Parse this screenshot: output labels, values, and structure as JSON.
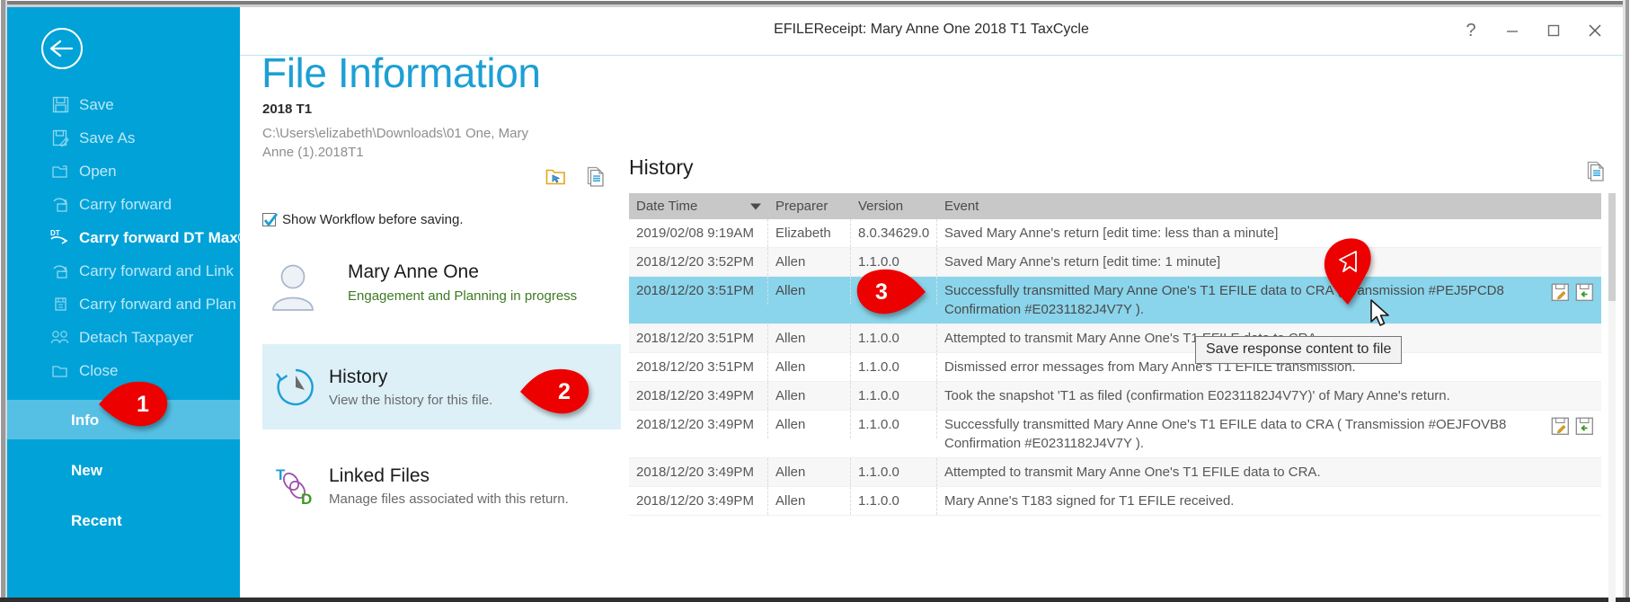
{
  "window": {
    "title": "EFILEReceipt: Mary Anne One 2018 T1 TaxCycle",
    "help_label": "?",
    "minimize_label": "Minimize",
    "maximize_label": "Maximize",
    "close_label": "Close"
  },
  "backstage": {
    "back_label": "Back",
    "items": [
      {
        "label": "Save",
        "icon": "save-icon",
        "enabled": false
      },
      {
        "label": "Save As",
        "icon": "save-as-icon",
        "enabled": false
      },
      {
        "label": "Open",
        "icon": "open-folder-icon",
        "enabled": false
      },
      {
        "label": "Carry forward",
        "icon": "carry-forward-icon",
        "enabled": false
      },
      {
        "label": "Carry forward DT Max®",
        "icon": "carry-forward-dtmax-icon",
        "enabled": true
      },
      {
        "label": "Carry forward and Link",
        "icon": "carry-forward-link-icon",
        "enabled": false
      },
      {
        "label": "Carry forward and Plan",
        "icon": "carry-forward-plan-icon",
        "enabled": false
      },
      {
        "label": "Detach Taxpayer",
        "icon": "detach-taxpayer-icon",
        "enabled": false
      },
      {
        "label": "Close",
        "icon": "close-folder-icon",
        "enabled": false
      }
    ],
    "sections": [
      {
        "label": "Info",
        "active": true
      },
      {
        "label": "New",
        "active": false
      },
      {
        "label": "Recent",
        "active": false
      }
    ]
  },
  "file_info": {
    "page_title": "File Information",
    "year_label": "2018 T1",
    "path": "C:\\Users\\elizabeth\\Downloads\\01 One, Mary Anne (1).2018T1",
    "open_folder_icon": "open-containing-folder-icon",
    "file_icon": "file-properties-icon",
    "workflow_checkbox_label": "Show Workflow before saving.",
    "workflow_checkbox_checked": true,
    "taxpayer": {
      "name": "Mary Anne One",
      "status": "Engagement and Planning in progress",
      "avatar_icon": "person-avatar-icon",
      "badge_icons": [
        "spouse-badge-icon",
        "taxpayer-badge-icon"
      ]
    },
    "cards": [
      {
        "title": "History",
        "subtitle": "View the history for this file.",
        "icon": "history-clock-icon",
        "selected": true
      },
      {
        "title": "Linked Files",
        "subtitle": "Manage files associated with this return.",
        "icon": "linked-files-icon",
        "selected": false
      }
    ]
  },
  "history": {
    "heading": "History",
    "doc_icon": "history-report-icon",
    "columns": [
      "Date Time",
      "Preparer",
      "Version",
      "Event"
    ],
    "sort_column": "Date Time",
    "sort_direction": "desc",
    "rows": [
      {
        "date": "2019/02/08 9:19AM",
        "preparer": "Elizabeth",
        "version": "8.0.34629.0",
        "event": "Saved Mary Anne's return [edit time: less than a minute]",
        "selected": false,
        "actions": []
      },
      {
        "date": "2018/12/20 3:52PM",
        "preparer": "Allen",
        "version": "1.1.0.0",
        "event": "Saved Mary Anne's return [edit time: 1 minute]",
        "selected": false,
        "actions": []
      },
      {
        "date": "2018/12/20 3:51PM",
        "preparer": "Allen",
        "version": "1.1.0.0",
        "event": "Successfully transmitted Mary Anne One's T1 EFILE data to CRA ( Transmission #PEJ5PCD8 Confirmation #E0231182J4V7Y ).",
        "selected": true,
        "actions": [
          "save-request-content-icon",
          "save-response-content-icon"
        ]
      },
      {
        "date": "2018/12/20 3:51PM",
        "preparer": "Allen",
        "version": "1.1.0.0",
        "event": "Attempted to transmit Mary Anne One's T1 EFILE data to CRA.",
        "selected": false,
        "actions": []
      },
      {
        "date": "2018/12/20 3:51PM",
        "preparer": "Allen",
        "version": "1.1.0.0",
        "event": "Dismissed error messages from Mary Anne's T1 EFILE transmission.",
        "selected": false,
        "actions": []
      },
      {
        "date": "2018/12/20 3:49PM",
        "preparer": "Allen",
        "version": "1.1.0.0",
        "event": "Took the snapshot 'T1 as filed (confirmation E0231182J4V7Y)' of Mary Anne's return.",
        "selected": false,
        "actions": []
      },
      {
        "date": "2018/12/20 3:49PM",
        "preparer": "Allen",
        "version": "1.1.0.0",
        "event": "Successfully transmitted Mary Anne One's T1 EFILE data to CRA ( Transmission #OEJFOVB8 Confirmation #E0231182J4V7Y ).",
        "selected": false,
        "actions": [
          "save-request-content-icon",
          "save-response-content-icon"
        ]
      },
      {
        "date": "2018/12/20 3:49PM",
        "preparer": "Allen",
        "version": "1.1.0.0",
        "event": "Attempted to transmit Mary Anne One's T1 EFILE data to CRA.",
        "selected": false,
        "actions": []
      },
      {
        "date": "2018/12/20 3:49PM",
        "preparer": "Allen",
        "version": "1.1.0.0",
        "event": "Mary Anne's T183 signed for T1 EFILE received.",
        "selected": false,
        "actions": []
      }
    ]
  },
  "tooltip": {
    "text": "Save response content to file"
  },
  "callouts": [
    {
      "number": "1",
      "target": "sidebar-item-info"
    },
    {
      "number": "2",
      "target": "history-card"
    },
    {
      "number": "3",
      "target": "selected-history-row"
    }
  ],
  "colors": {
    "accent_blue": "#00a2d8",
    "title_blue": "#1d9fd4",
    "selected_row": "#8ad5ec",
    "card_selected": "#ddf0f8",
    "callout_red": "#ec0000",
    "status_green": "#3f7a23",
    "header_gray": "#c8c8c8"
  }
}
